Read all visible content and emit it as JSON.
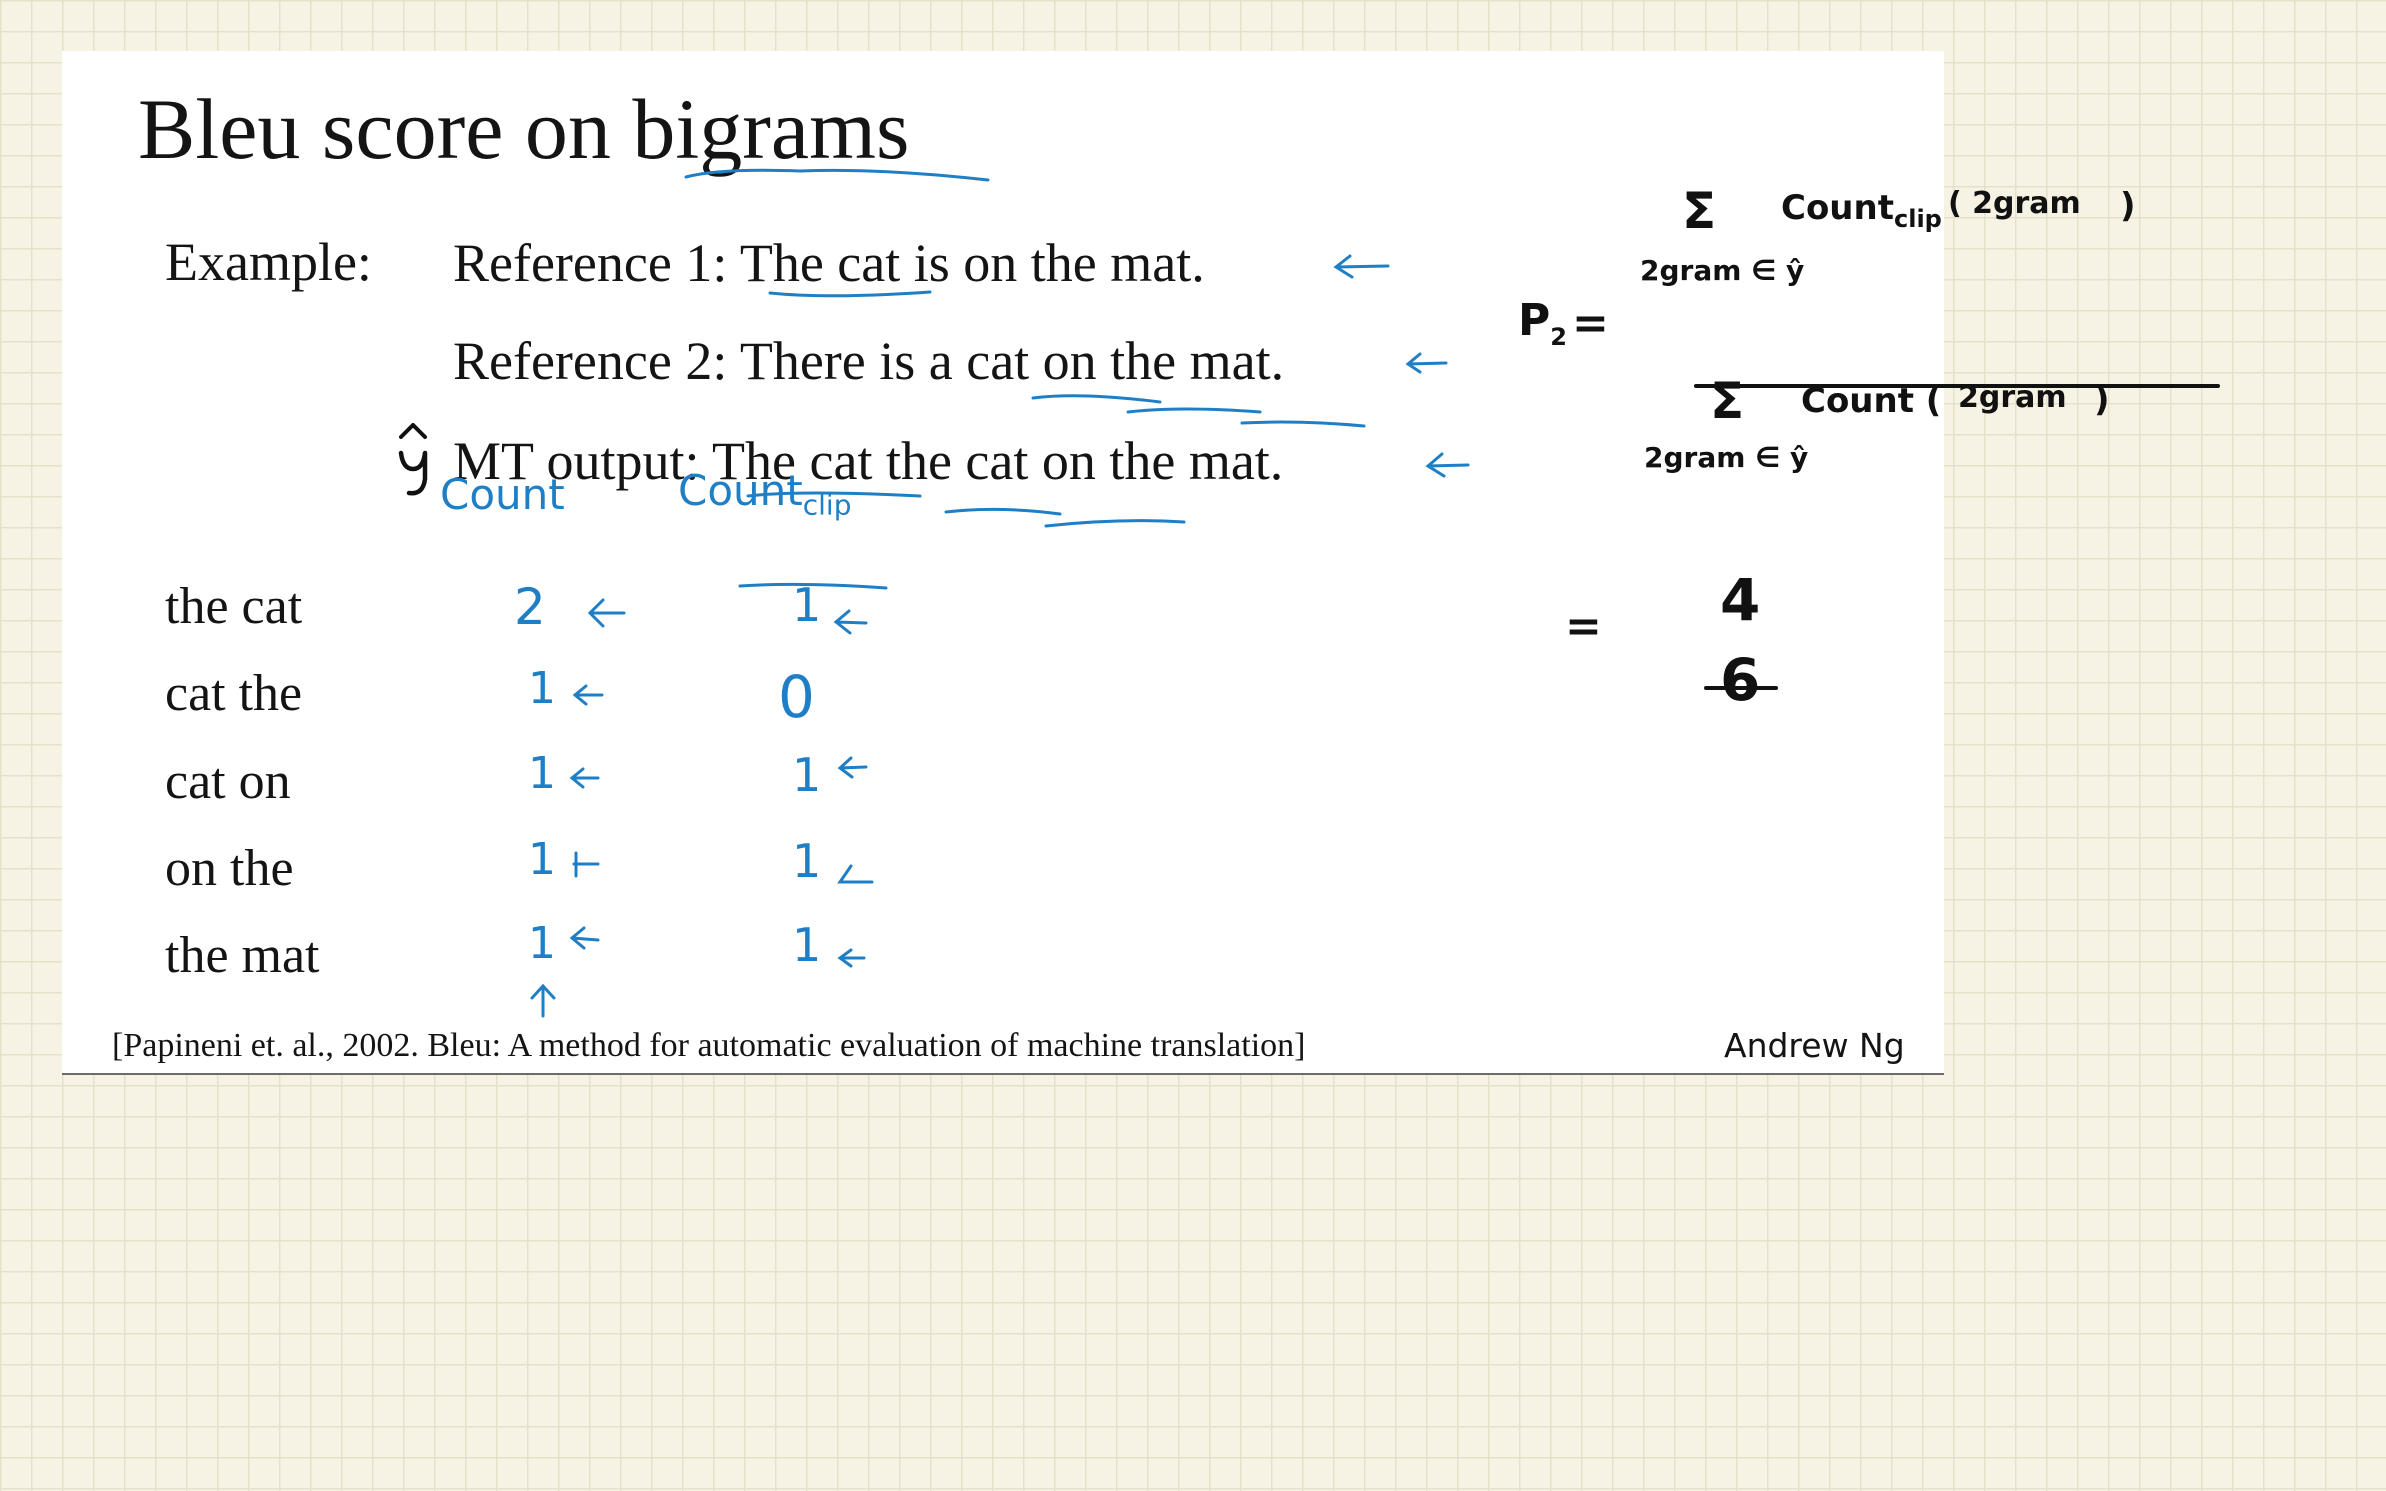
{
  "slide": {
    "title": "Bleu score on bigrams",
    "example_label": "Example:",
    "reference_1": "Reference 1: The cat is on the mat.",
    "reference_2": "Reference 2: There is a cat on the mat.",
    "mt_output": "MT output: The cat the cat on the mat.",
    "bigrams": [
      "the cat",
      "cat the",
      "cat on",
      "on the",
      "the mat"
    ],
    "citation": "[Papineni et. al., 2002. Bleu: A method for automatic evaluation of machine translation]",
    "author": "Andrew Ng"
  },
  "annotations": {
    "yhat_symbol": "ŷ",
    "count_header": "Count",
    "count_clip_header": "Count",
    "count_clip_subscript": "clip",
    "counts": [
      "2",
      "1",
      "1",
      "1",
      "1"
    ],
    "count_clips": [
      "1",
      "0",
      "1",
      "1",
      "1"
    ],
    "formula": {
      "p_symbol": "P",
      "p_subscript": "2",
      "equals": "=",
      "sigma": "Σ",
      "numerator_term": "Count",
      "numerator_subscript": "clip",
      "numerator_arg": "( 2gram",
      "close_paren": ")",
      "numerator_sum_subscript": "2gram ∈ ŷ",
      "denominator_term": "Count (",
      "denominator_arg": "2gram",
      "denominator_sum_subscript": "2gram ∈ ŷ",
      "result_numerator": "4",
      "result_denominator": "6"
    }
  },
  "colors": {
    "ink_blue": "#1f7fc6",
    "ink_black": "#111111",
    "grid_line": "#e4e0cc",
    "paper": "#f6f3e4"
  }
}
